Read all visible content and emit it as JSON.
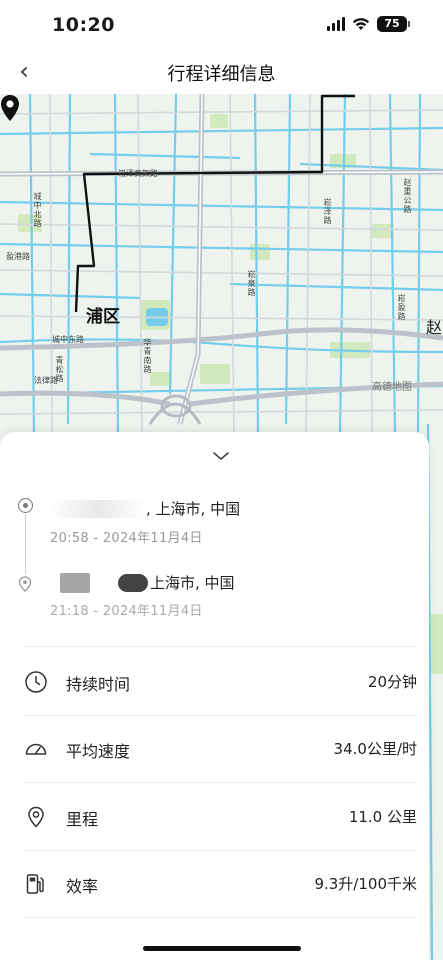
{
  "status_bar": {
    "time": "10:20",
    "battery": "75"
  },
  "nav": {
    "back_icon": "chevron-left-icon",
    "back_glyph": "‹",
    "title": "行程详细信息"
  },
  "map": {
    "district_left": "浦区",
    "district_right": "赵",
    "watermark": "高德地图",
    "road_labels": {
      "expressway": "崧泽高架路",
      "chengzhong_north": "城中北路",
      "yinggang": "盈港路",
      "chengzhong": "城中东路",
      "qingsong": "青松路",
      "fajing": "法律路",
      "huaqing": "华青南路",
      "songze": "崧泽路",
      "songhua": "崧华路",
      "zhaochong": "赵重公路",
      "songhua2": "崧盈路",
      "songqian": "崧泉路"
    },
    "colors": {
      "water": "#74cdea",
      "road": "#c8cdd3",
      "route": "#111111",
      "green": "#cfe8b8"
    }
  },
  "sheet": {
    "collapse_icon": "chevron-down-icon",
    "start": {
      "address_suffix": ", 上海市, 中国",
      "time": "20:58 - 2024年11月4日"
    },
    "end": {
      "address_suffix": "上海市, 中国",
      "time": "21:18 - 2024年11月4日"
    },
    "stats": [
      {
        "icon": "clock-icon",
        "label": "持续时间",
        "value": "20分钟"
      },
      {
        "icon": "speedometer-icon",
        "label": "平均速度",
        "value": "34.0公里/时"
      },
      {
        "icon": "location-pin-icon",
        "label": "里程",
        "value": "11.0 公里"
      },
      {
        "icon": "fuel-pump-icon",
        "label": "效率",
        "value": "9.3升/100千米"
      }
    ]
  }
}
